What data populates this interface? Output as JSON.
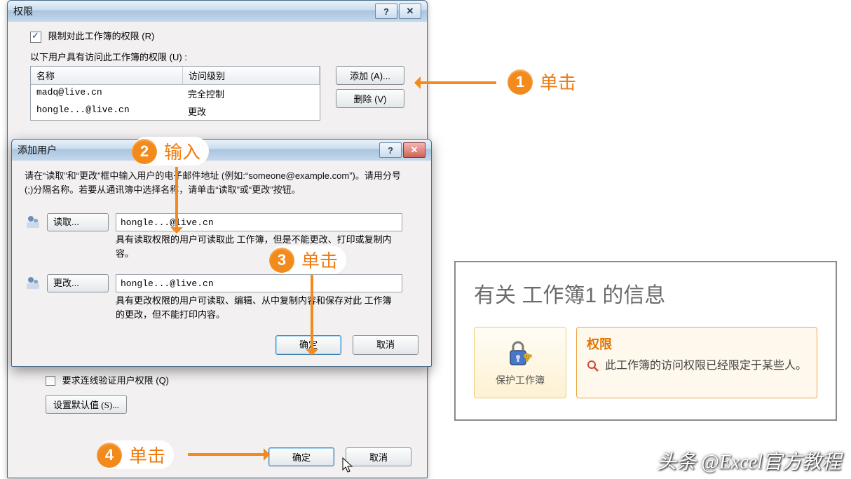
{
  "annotations": {
    "step1": "单击",
    "step2": "输入",
    "step3": "单击",
    "step4": "单击"
  },
  "main_dialog": {
    "title": "权限",
    "restrict_checkbox_label": "限制对此工作簿的权限 (R)",
    "restrict_checked": true,
    "users_label": "以下用户具有访问此工作簿的权限 (U) :",
    "table": {
      "col_name": "名称",
      "col_level": "访问级别",
      "rows": [
        {
          "name": "madq@live.cn",
          "level": "完全控制"
        },
        {
          "name": "hongle...@live.cn",
          "level": "更改"
        }
      ]
    },
    "add_btn": "添加 (A)...",
    "remove_btn": "删除 (V)",
    "require_conn_label": "要求连线验证用户权限 (Q)",
    "set_default_btn": "设置默认值 (S)...",
    "ok_btn": "确定",
    "cancel_btn": "取消"
  },
  "add_dialog": {
    "title": "添加用户",
    "instruction": "请在“读取”和“更改”框中输入用户的电子邮件地址 (例如:“someone@example.com”)。请用分号(;)分隔名称。若要从通讯簿中选择名称，请单击“读取”或“更改”按钮。",
    "read_btn": "读取...",
    "read_value": "hongle...@live.cn",
    "read_desc": "具有读取权限的用户可读取此 工作簿，但是不能更改、打印或复制内容。",
    "change_btn": "更改...",
    "change_value": "hongle...@live.cn",
    "change_desc": "具有更改权限的用户可读取、编辑、从中复制内容和保存对此 工作簿 的更改，但不能打印内容。",
    "ok_btn": "确定",
    "cancel_btn": "取消"
  },
  "info_panel": {
    "title": "有关 工作簿1 的信息",
    "protect_label": "保护工作簿",
    "perm_title": "权限",
    "perm_desc": "此工作簿的访问权限已经限定于某些人。"
  },
  "watermark": "头条 @Excel官方教程"
}
